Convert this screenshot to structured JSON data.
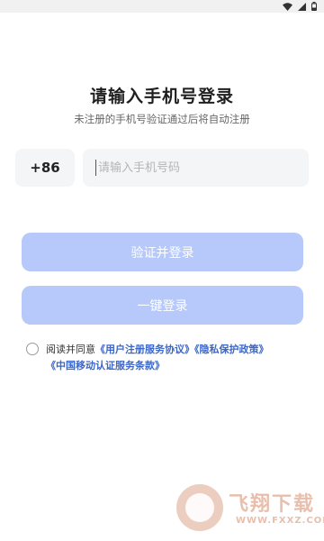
{
  "status_bar": {
    "icons": [
      "wifi-icon",
      "signal-icon",
      "battery-icon"
    ]
  },
  "header": {
    "title": "请输入手机号登录",
    "subtitle": "未注册的手机号验证通过后将自动注册"
  },
  "phone_form": {
    "country_code": "+86",
    "phone_placeholder": "请输入手机号码",
    "phone_value": ""
  },
  "buttons": {
    "verify_login": "验证并登录",
    "one_click_login": "一键登录",
    "disabled_color": "#b7c9fb"
  },
  "agreement": {
    "checked": false,
    "prefix": "阅读并同意",
    "user_agreement": "《用户注册服务协议》",
    "privacy_policy": "《隐私保护政策》",
    "cmcc_terms": "《中国移动认证服务条款》",
    "link_color": "#3d67c7"
  },
  "watermark": {
    "brand": "飞翔下载",
    "url": "WWW.FXXZ.COM"
  }
}
